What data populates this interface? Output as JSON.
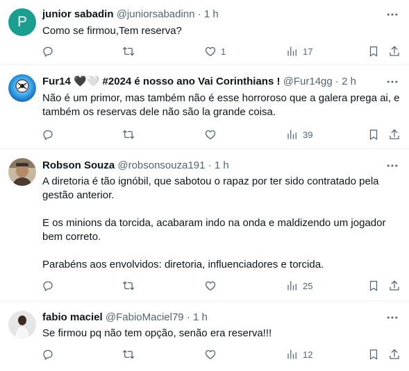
{
  "tweets": [
    {
      "name": "junior sabadin",
      "handle": "@juniorsabadinn",
      "separator": "·",
      "time": "1 h",
      "avatar_letter": "P",
      "lines": [
        "Como se firmou,Tem reserva?"
      ],
      "replies": "",
      "retweets": "",
      "likes": "1",
      "views": "17"
    },
    {
      "name": "Fur14 🖤🤍 #2024 é nosso ano Vai Corinthians !",
      "handle": "@Fur14gg",
      "separator": "·",
      "time": "2 h",
      "lines": [
        "Não é um primor, mas também não é esse horroroso que a galera prega ai, e",
        "também os reservas dele não são la grande coisa."
      ],
      "replies": "",
      "retweets": "",
      "likes": "",
      "views": "39"
    },
    {
      "name": "Robson Souza",
      "handle": "@robsonsouza191",
      "separator": "·",
      "time": "1 h",
      "lines": [
        "A diretoria é tão ignóbil, que sabotou o rapaz por ter sido contratado pela",
        "gestão anterior.",
        "",
        "E os minions da torcida, acabaram indo na onda e maldizendo um jogador",
        "bem correto.",
        "",
        "Parabéns aos envolvidos: diretoria, influenciadores e torcida."
      ],
      "replies": "",
      "retweets": "",
      "likes": "",
      "views": "25"
    },
    {
      "name": "fabio maciel",
      "handle": "@FabioMaciel79",
      "separator": "·",
      "time": "1 h",
      "lines": [
        "Se firmou pq não tem opção, senão era reserva!!!"
      ],
      "replies": "",
      "retweets": "",
      "likes": "",
      "views": "12"
    }
  ],
  "icons": {
    "reply": "reply-icon",
    "retweet": "retweet-icon",
    "like": "heart-icon",
    "views": "views-icon",
    "bookmark": "bookmark-icon",
    "share": "share-icon",
    "more": "more-icon"
  },
  "colors": {
    "text": "#0f1419",
    "secondary": "#536471",
    "divider": "#eff3f4",
    "avatar_p": "#1a9e8f"
  }
}
